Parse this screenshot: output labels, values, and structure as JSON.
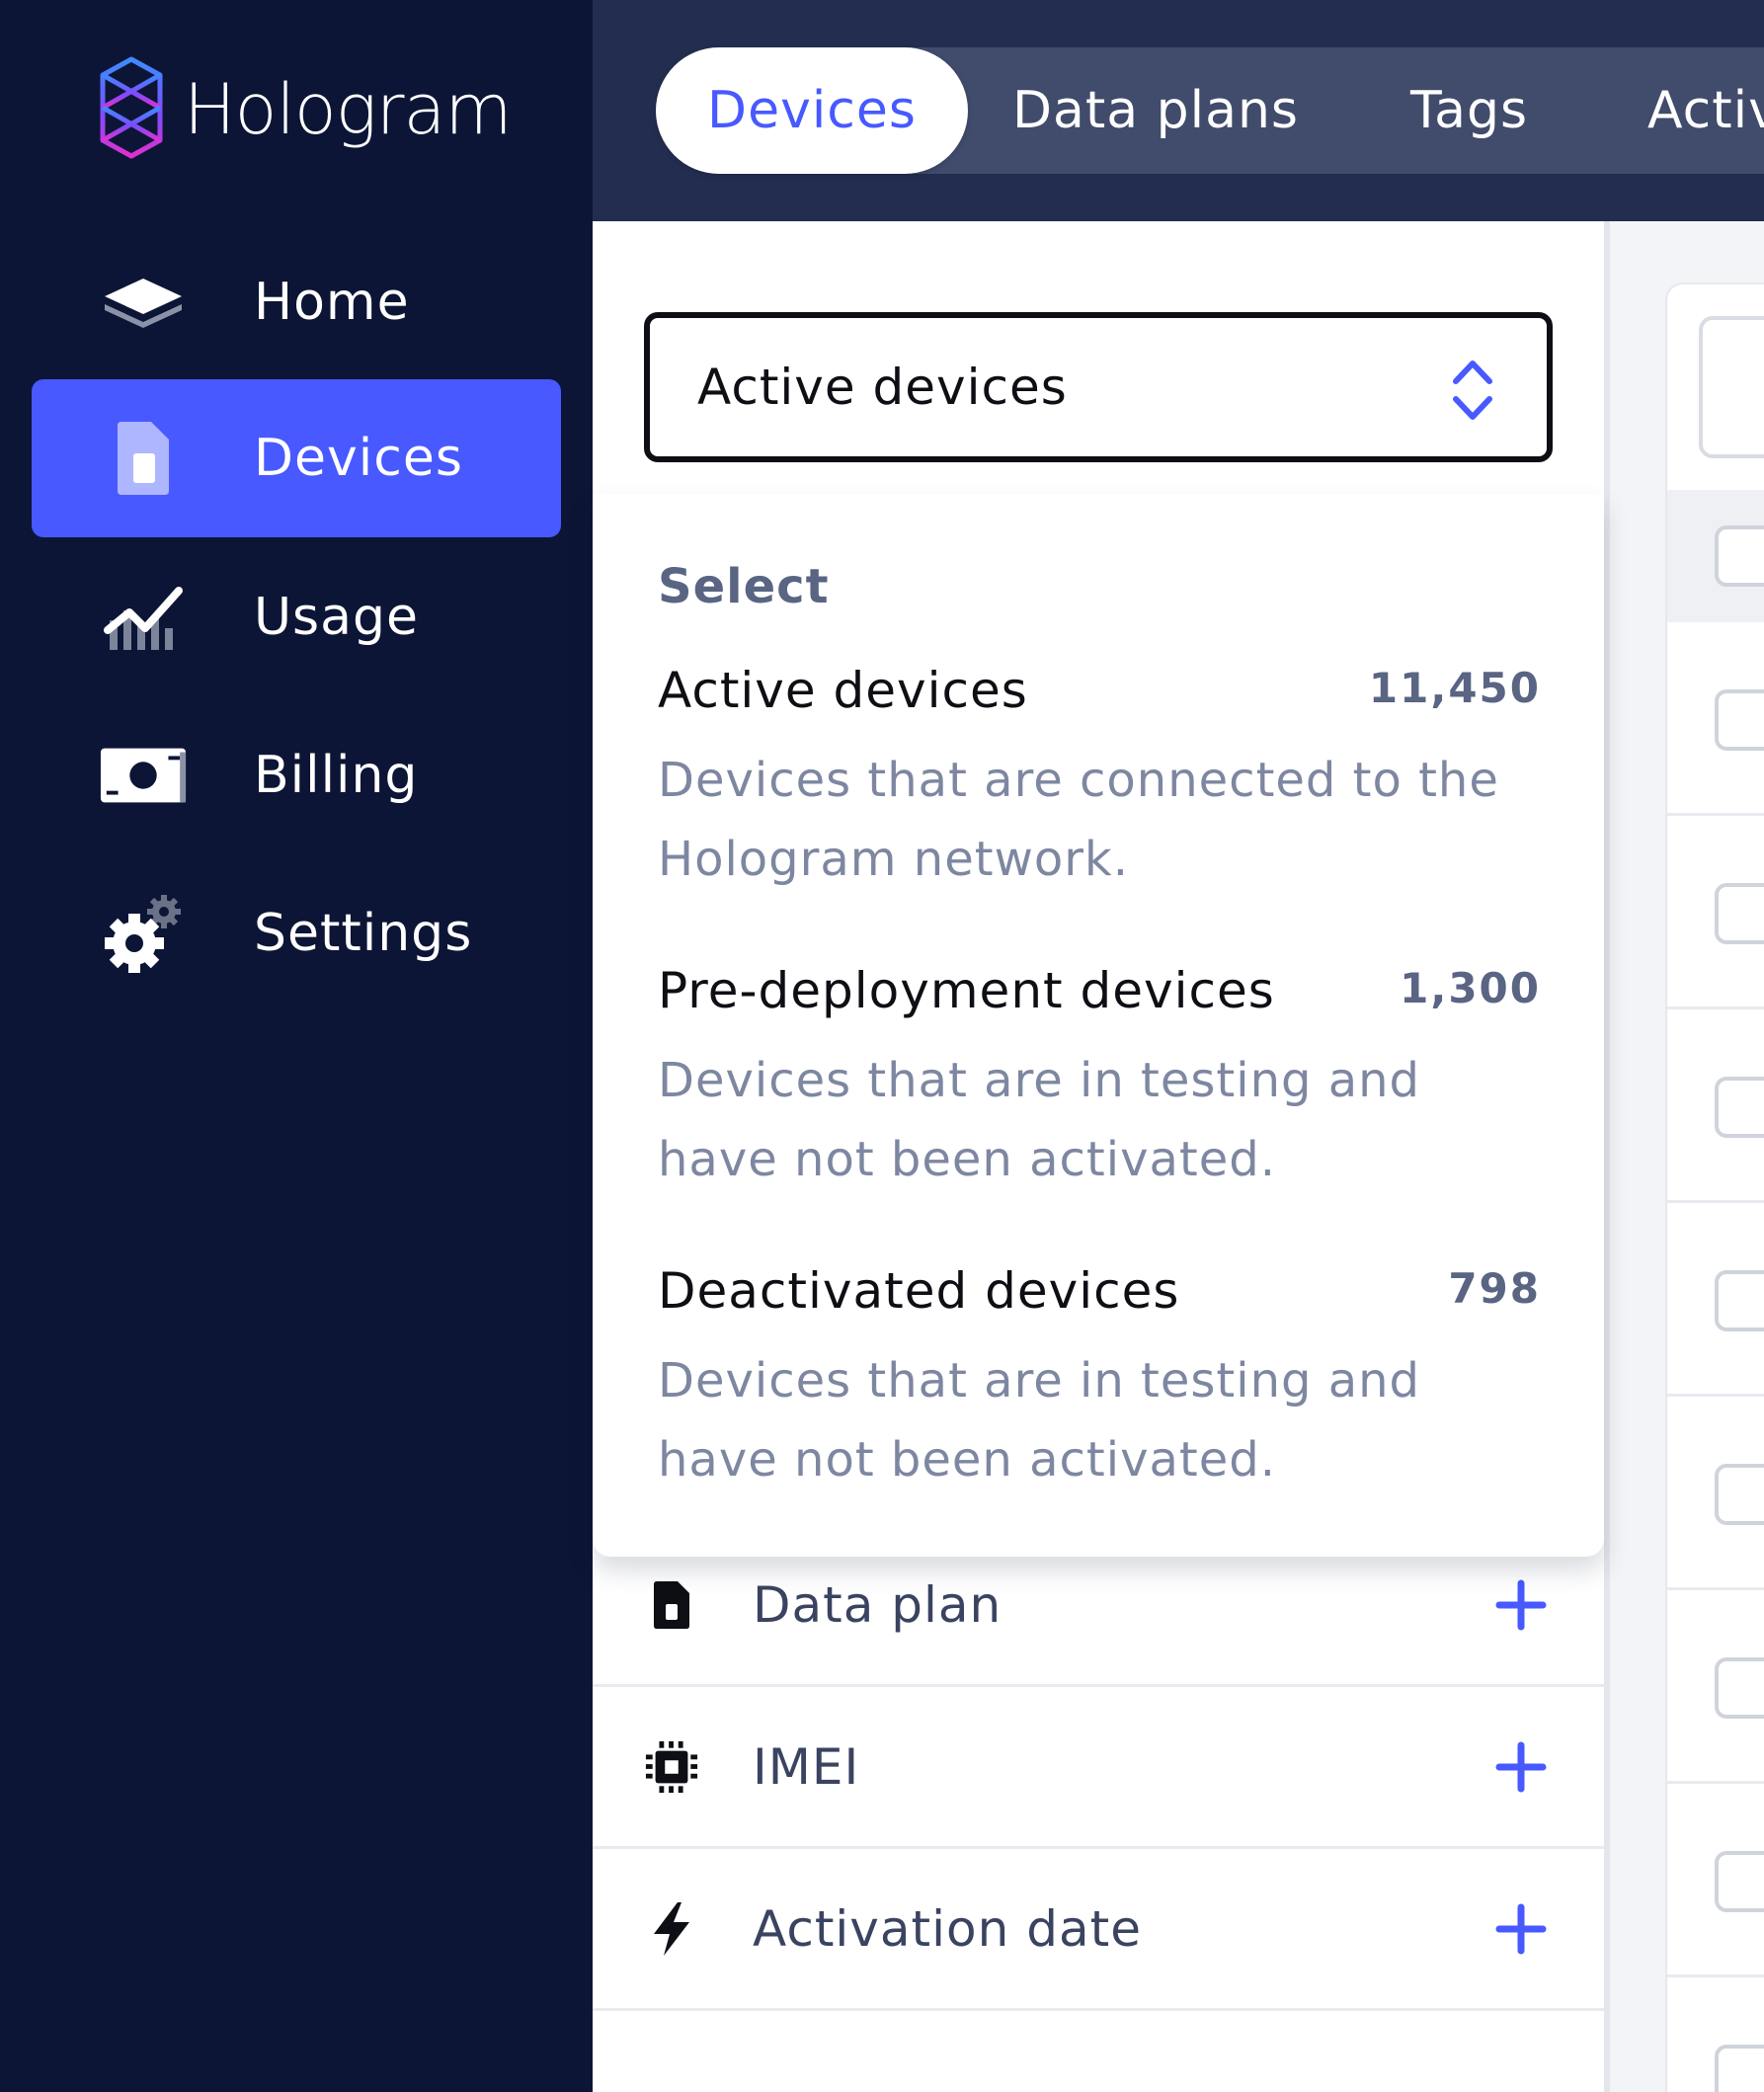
{
  "brand": {
    "name": "Hologram",
    "logo_icon": "hologram-logo-icon"
  },
  "sidebar": {
    "items": [
      {
        "label": "Home",
        "icon": "home-layers-icon",
        "active": false
      },
      {
        "label": "Devices",
        "icon": "sim-card-icon",
        "active": true
      },
      {
        "label": "Usage",
        "icon": "usage-chart-icon",
        "active": false
      },
      {
        "label": "Billing",
        "icon": "billing-cash-icon",
        "active": false
      },
      {
        "label": "Settings",
        "icon": "settings-gear-icon",
        "active": false
      }
    ]
  },
  "tabs": [
    {
      "label": "Devices",
      "active": true
    },
    {
      "label": "Data plans",
      "active": false
    },
    {
      "label": "Tags",
      "active": false
    },
    {
      "label": "Activ",
      "active": false
    }
  ],
  "device_filter": {
    "selected": "Active devices",
    "dropdown": {
      "header": "Select",
      "options": [
        {
          "title": "Active devices",
          "count": "11,450",
          "description": "Devices that are connected to the Hologram network."
        },
        {
          "title": "Pre-deployment devices",
          "count": "1,300",
          "description": "Devices that are in testing and have not been activated."
        },
        {
          "title": "Deactivated devices",
          "count": "798",
          "description": "Devices that are in testing and have not been activated."
        }
      ]
    }
  },
  "filters": [
    {
      "label": "Data plan",
      "icon": "sim-card-icon"
    },
    {
      "label": "IMEI",
      "icon": "chip-icon"
    },
    {
      "label": "Activation date",
      "icon": "lightning-icon"
    }
  ],
  "colors": {
    "sidebar_bg": "#0c1535",
    "accent": "#4759ff",
    "topbar_bg": "#232d4f",
    "muted_text": "#7e87a1"
  }
}
